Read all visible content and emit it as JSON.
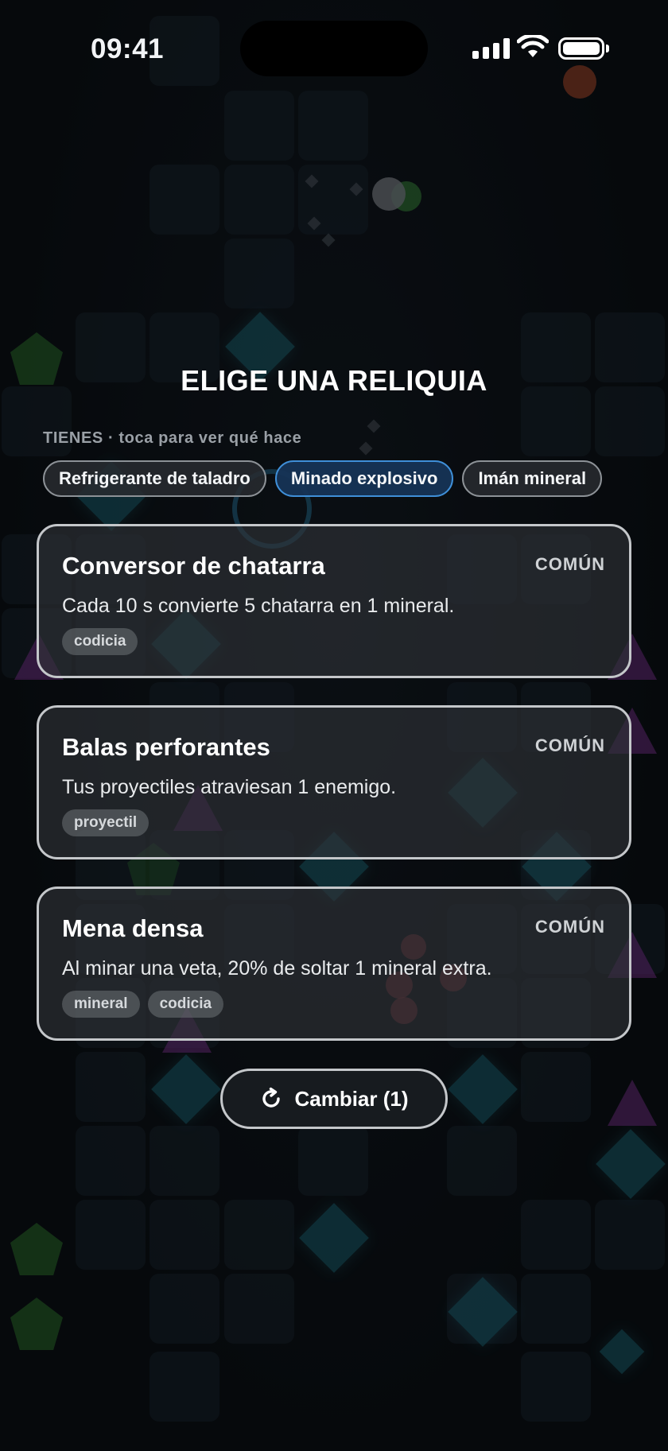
{
  "status_bar": {
    "time": "09:41",
    "icons": [
      "cellular-signal-icon",
      "wifi-icon",
      "battery-icon"
    ]
  },
  "screen": {
    "title": "ELIGE UNA RELIQUIA",
    "owned_caption": "TIENES · toca para ver qué hace",
    "owned_relics": [
      {
        "label": "Refrigerante de taladro",
        "selected": false
      },
      {
        "label": "Minado explosivo",
        "selected": true
      },
      {
        "label": "Imán mineral",
        "selected": false
      }
    ],
    "choices": [
      {
        "name": "Conversor de chatarra",
        "rarity": "COMÚN",
        "description": "Cada 10 s convierte 5 chatarra en 1 mineral.",
        "tags": [
          "codicia"
        ]
      },
      {
        "name": "Balas perforantes",
        "rarity": "COMÚN",
        "description": "Tus proyectiles atraviesan 1 enemigo.",
        "tags": [
          "proyectil"
        ]
      },
      {
        "name": "Mena densa",
        "rarity": "COMÚN",
        "description": "Al minar una veta, 20% de soltar 1 mineral extra.",
        "tags": [
          "mineral",
          "codicia"
        ]
      }
    ],
    "reroll": {
      "label": "Cambiar (1)",
      "icon": "refresh-icon"
    }
  },
  "colors": {
    "background": "#080b0f",
    "selected_pill": "#3f8fd8",
    "card_border": "#c4c7ca",
    "gem": "#1b6b7a",
    "pentagon": "#2f7a2c",
    "triangle": "#7a2f8c",
    "orb": "#a03a3f"
  }
}
